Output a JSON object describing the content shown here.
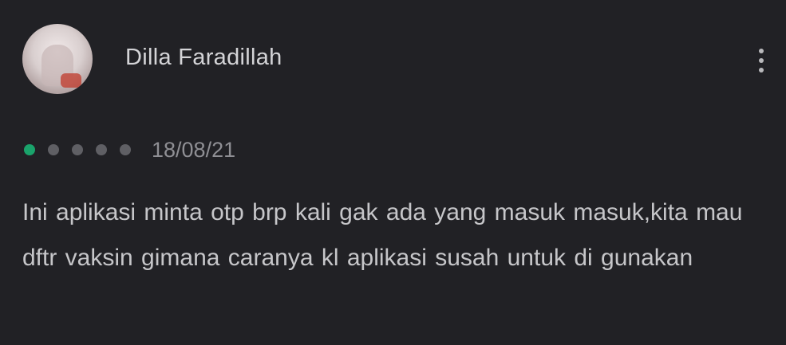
{
  "review": {
    "reviewer_name": "Dilla Faradillah",
    "rating": 1,
    "max_rating": 5,
    "date": "18/08/21",
    "text": "Ini aplikasi minta otp brp kali gak ada yang masuk masuk,kita mau dftr vaksin gimana caranya kl aplikasi susah untuk di gunakan"
  },
  "icons": {
    "avatar": "user-avatar-photo",
    "menu": "more-vertical-icon",
    "star": "star-icon"
  },
  "colors": {
    "background": "#212125",
    "star_filled": "#1aa36b",
    "star_empty": "#5f5f64"
  }
}
